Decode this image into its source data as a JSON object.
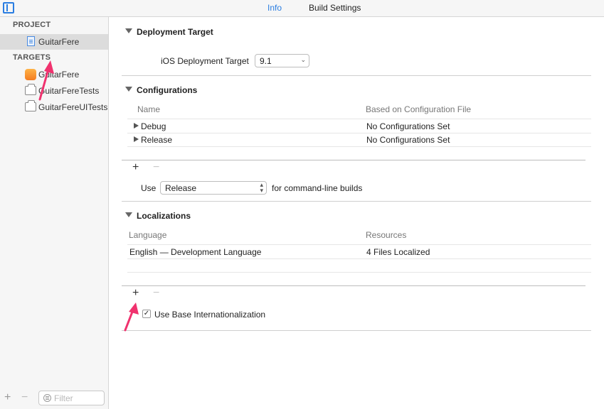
{
  "topbar": {
    "tabs": [
      {
        "label": "Info",
        "active": true
      },
      {
        "label": "Build Settings",
        "active": false
      }
    ]
  },
  "sidebar": {
    "project_header": "PROJECT",
    "project_item": {
      "label": "GuitarFere",
      "icon": "project-file-icon"
    },
    "targets_header": "TARGETS",
    "targets": [
      {
        "label": "GuitarFere",
        "icon": "app-icon"
      },
      {
        "label": "GuitarFereTests",
        "icon": "bundle-icon"
      },
      {
        "label": "GuitarFereUITests",
        "icon": "bundle-icon"
      }
    ],
    "footer": {
      "add": "+",
      "remove": "−",
      "filter_placeholder": "Filter"
    }
  },
  "deployment": {
    "title": "Deployment Target",
    "field_label": "iOS Deployment Target",
    "value": "9.1"
  },
  "configurations": {
    "title": "Configurations",
    "columns": [
      "Name",
      "Based on Configuration File"
    ],
    "rows": [
      {
        "name": "Debug",
        "file": "No Configurations Set"
      },
      {
        "name": "Release",
        "file": "No Configurations Set"
      }
    ],
    "add": "+",
    "remove": "−",
    "use_label": "Use",
    "use_value": "Release",
    "use_suffix": "for command-line builds"
  },
  "localizations": {
    "title": "Localizations",
    "columns": [
      "Language",
      "Resources"
    ],
    "rows": [
      {
        "language": "English — Development Language",
        "resources": "4 Files Localized"
      }
    ],
    "add": "+",
    "remove": "−",
    "checkbox_label": "Use Base Internationalization",
    "checkbox_checked": true,
    "checkmark": "✓"
  },
  "colors": {
    "accent": "#2a7de1",
    "annotation": "#f0326e"
  }
}
